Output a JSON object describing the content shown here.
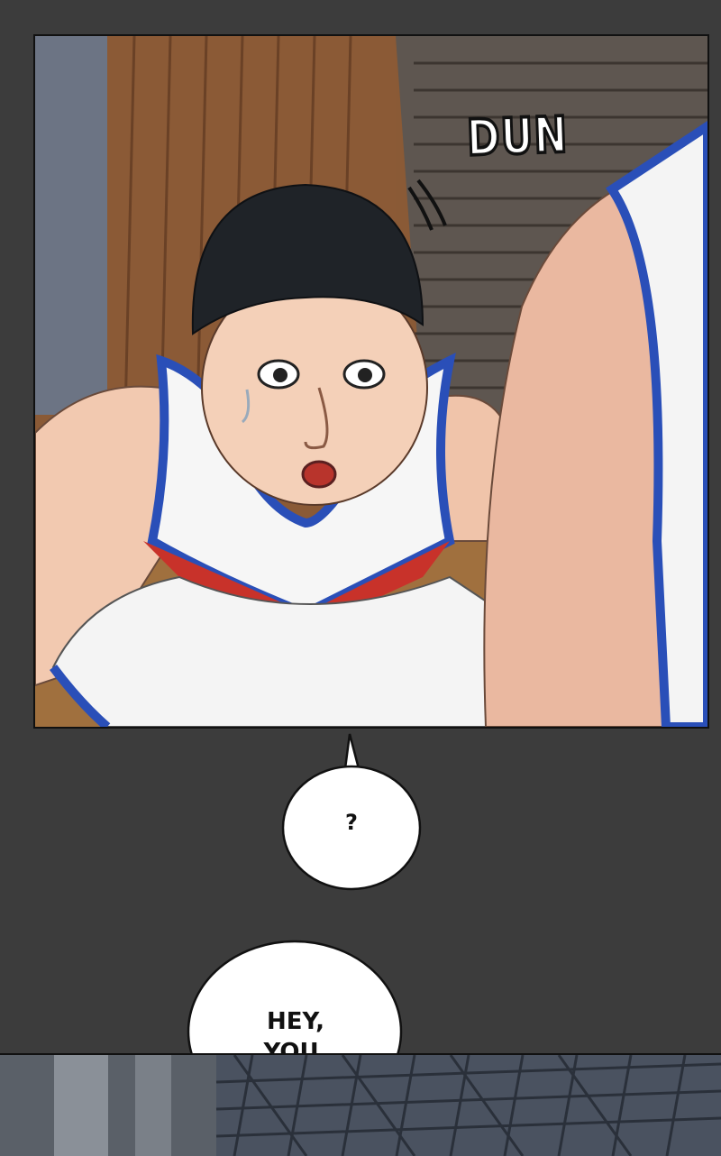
{
  "panel1": {
    "sfx_text": "DUN"
  },
  "bubble_question": {
    "text": "?"
  },
  "bubble_hey": {
    "line1": "HEY,",
    "line2": "YOU."
  },
  "colors": {
    "gutter": "#3c3c3c",
    "bubble_fill": "#ffffff",
    "jersey_blue": "#2a4fb8",
    "jersey_red": "#c8322a"
  }
}
